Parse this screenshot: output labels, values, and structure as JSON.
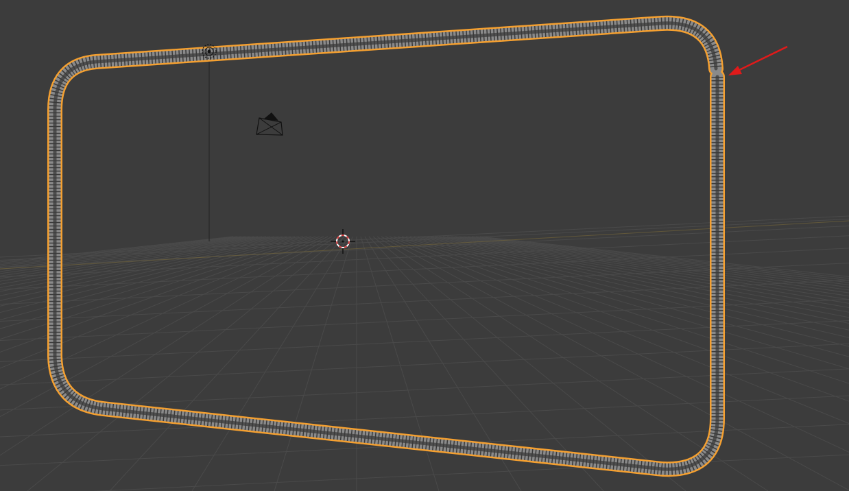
{
  "viewport": {
    "background": "#3c3c3c",
    "grid_color": "#4a4a4a",
    "selection_outline_color": "#f5a030",
    "coil_color": "#8a8a8a",
    "annotation_color": "#e01a1a"
  },
  "scene_objects": [
    {
      "kind": "spring-coil-curve",
      "selected": true
    },
    {
      "kind": "light-icon"
    },
    {
      "kind": "camera-icon"
    },
    {
      "kind": "3d-cursor-icon"
    },
    {
      "kind": "red-arrow-annotation"
    }
  ]
}
